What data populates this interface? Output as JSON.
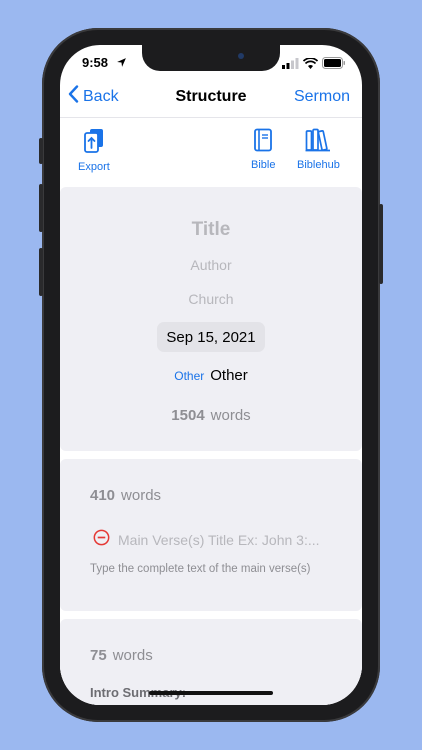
{
  "status": {
    "time": "9:58"
  },
  "nav": {
    "back_label": "Back",
    "title": "Structure",
    "action_label": "Sermon"
  },
  "toolbar": {
    "export_label": "Export",
    "bible_label": "Bible",
    "biblehub_label": "Biblehub"
  },
  "header_card": {
    "title_placeholder": "Title",
    "author_placeholder": "Author",
    "church_placeholder": "Church",
    "date": "Sep 15, 2021",
    "category_button": "Other",
    "category_value": "Other",
    "word_count": "1504",
    "word_label": "words"
  },
  "verse_card": {
    "word_count": "410",
    "word_label": "words",
    "title_placeholder": "Main Verse(s) Title Ex: John 3:...",
    "text_placeholder": "Type the complete text of the main verse(s)"
  },
  "intro_card": {
    "word_count": "75",
    "word_label": "words",
    "summary_label": "Intro Summary:"
  },
  "colors": {
    "accent": "#1a73e8",
    "remove": "#e53935",
    "card_bg": "#efeff4",
    "background": "#9bb8f0"
  }
}
